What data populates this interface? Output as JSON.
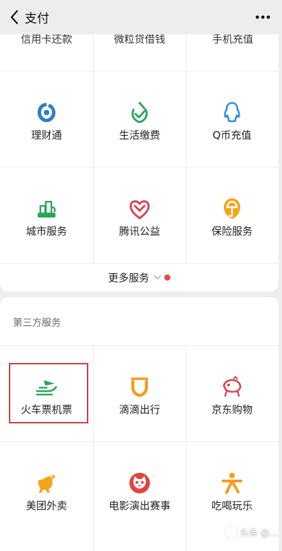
{
  "header": {
    "title": "支付"
  },
  "top_partial": [
    "信用卡还款",
    "微粒贷借钱",
    "手机充值"
  ],
  "services": [
    {
      "label": "理财通",
      "icon": "wealth-icon"
    },
    {
      "label": "生活缴费",
      "icon": "utility-icon"
    },
    {
      "label": "Q币充值",
      "icon": "qq-coin-icon"
    },
    {
      "label": "城市服务",
      "icon": "city-icon"
    },
    {
      "label": "腾讯公益",
      "icon": "charity-icon"
    },
    {
      "label": "保险服务",
      "icon": "insurance-icon"
    }
  ],
  "more_services": {
    "label": "更多服务"
  },
  "third_party": {
    "title": "第三方服务",
    "items": [
      {
        "label": "火车票机票",
        "icon": "train-plane-icon"
      },
      {
        "label": "滴滴出行",
        "icon": "didi-icon"
      },
      {
        "label": "京东购物",
        "icon": "jd-icon"
      },
      {
        "label": "美团外卖",
        "icon": "meituan-icon"
      },
      {
        "label": "电影演出赛事",
        "icon": "maoyan-icon"
      },
      {
        "label": "吃喝玩乐",
        "icon": "dianping-icon"
      }
    ]
  },
  "watermark": "头条 @..."
}
